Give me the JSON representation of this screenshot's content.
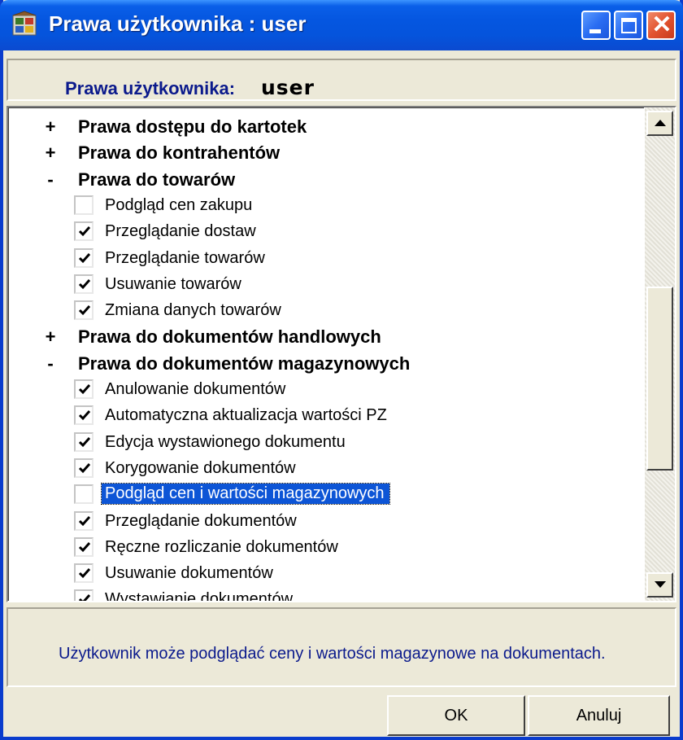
{
  "window": {
    "title": "Prawa użytkownika : user",
    "close_glyph": "✕"
  },
  "header": {
    "label": "Prawa użytkownika:",
    "user": "user"
  },
  "tree": {
    "rows": [
      {
        "type": "group",
        "sign": "+",
        "label": "Prawa dostępu do kartotek"
      },
      {
        "type": "group",
        "sign": "+",
        "label": "Prawa do kontrahentów"
      },
      {
        "type": "group",
        "sign": "-",
        "label": "Prawa do towarów"
      },
      {
        "type": "item",
        "checked": false,
        "label": "Podgląd cen zakupu"
      },
      {
        "type": "item",
        "checked": true,
        "label": "Przeglądanie dostaw"
      },
      {
        "type": "item",
        "checked": true,
        "label": "Przeglądanie towarów"
      },
      {
        "type": "item",
        "checked": true,
        "label": "Usuwanie towarów"
      },
      {
        "type": "item",
        "checked": true,
        "label": "Zmiana danych towarów"
      },
      {
        "type": "group",
        "sign": "+",
        "label": "Prawa do dokumentów handlowych"
      },
      {
        "type": "group",
        "sign": "-",
        "label": "Prawa do dokumentów magazynowych"
      },
      {
        "type": "item",
        "checked": true,
        "label": "Anulowanie dokumentów"
      },
      {
        "type": "item",
        "checked": true,
        "label": "Automatyczna aktualizacja wartości PZ"
      },
      {
        "type": "item",
        "checked": true,
        "label": "Edycja wystawionego dokumentu"
      },
      {
        "type": "item",
        "checked": true,
        "label": "Korygowanie dokumentów"
      },
      {
        "type": "item",
        "checked": false,
        "selected": true,
        "label": "Podgląd cen i wartości magazynowych"
      },
      {
        "type": "item",
        "checked": true,
        "label": "Przeglądanie dokumentów"
      },
      {
        "type": "item",
        "checked": true,
        "label": "Ręczne rozliczanie dokumentów"
      },
      {
        "type": "item",
        "checked": true,
        "label": "Usuwanie dokumentów"
      },
      {
        "type": "item",
        "checked": true,
        "label": "Wystawianie dokumentów"
      }
    ]
  },
  "description": "Użytkownik może podglądać ceny i wartości magazynowe na dokumentach.",
  "buttons": {
    "ok": "OK",
    "cancel": "Anuluj"
  },
  "colors": {
    "titlebar": "#0554dc",
    "selection": "#0d55d6",
    "accent_text": "#0b1a8c",
    "face": "#ece9d8"
  }
}
